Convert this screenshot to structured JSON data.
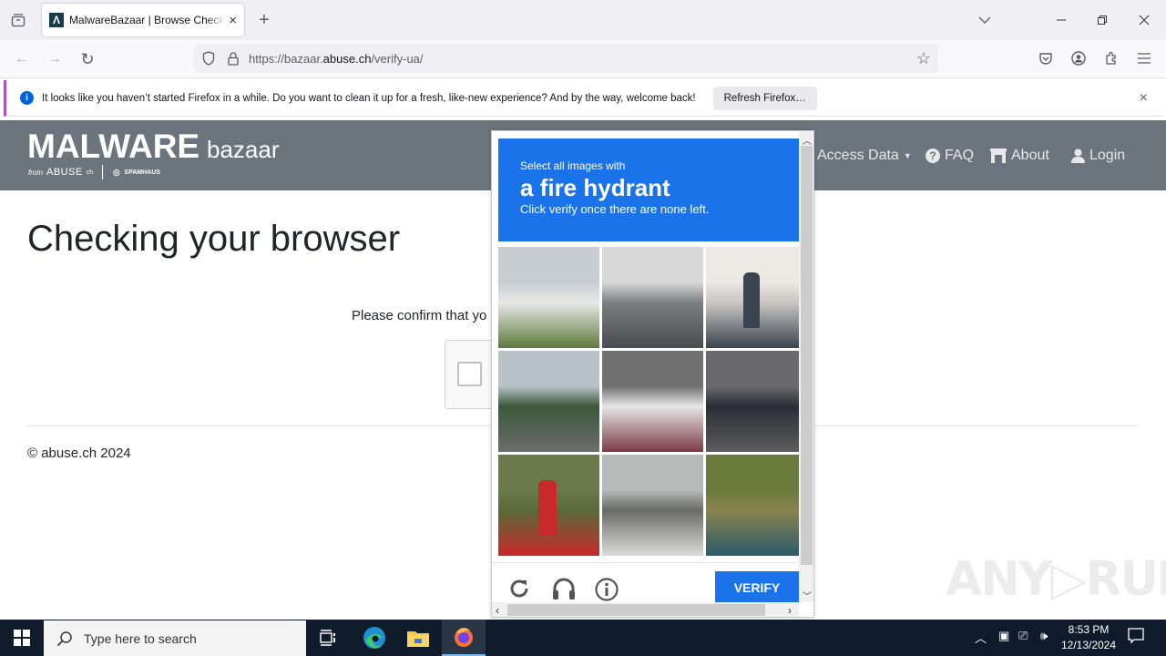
{
  "browser": {
    "tab_title": "MalwareBazaar | Browse Checking your browser",
    "tab_favicon": "Λ",
    "new_tab": "+",
    "url_prefix": "https://bazaar.",
    "url_domain": "abuse.ch",
    "url_path": "/verify-ua/",
    "icons": [
      "tab-list-icon",
      "back-icon",
      "forward-icon",
      "reload-icon",
      "shield-icon",
      "lock-icon",
      "star-icon",
      "pocket-icon",
      "account-icon",
      "extensions-icon",
      "menu-icon",
      "list-all-tabs-icon",
      "minimize-icon",
      "restore-icon",
      "close-icon"
    ]
  },
  "notification": {
    "message": "It looks like you haven’t started Firefox in a while. Do you want to clean it up for a fresh, like-new experience? And by the way, welcome back!",
    "button": "Refresh Firefox…",
    "close": "×"
  },
  "site": {
    "logo_main": "MALWARE",
    "logo_sub": "bazaar",
    "logo_from": "from",
    "logo_abuse": "ABUSE",
    "logo_ch": "ch",
    "logo_spamhaus": "SPAMHAUS",
    "nav": [
      {
        "label": "Access Data",
        "icon": "caret-down-icon"
      },
      {
        "label": "FAQ",
        "icon": "question-circle-icon"
      },
      {
        "label": "About",
        "icon": "building-icon"
      },
      {
        "label": "Login",
        "icon": "user-icon"
      }
    ]
  },
  "page": {
    "title": "Checking your browser",
    "confirm_text": "Please confirm that yo",
    "copyright": "© abuse.ch 2024"
  },
  "captcha": {
    "line1": "Select all images with",
    "target": "a fire hydrant",
    "line3": "Click verify once there are none left.",
    "tiles": [
      {
        "desc": "house",
        "colors": [
          "#c8cdd2",
          "#e8e8e6",
          "#5c7a3a"
        ]
      },
      {
        "desc": "highway traffic",
        "colors": [
          "#d8d8d8",
          "#7c7e80",
          "#4a4c50"
        ]
      },
      {
        "desc": "fire hydrant on sidewalk",
        "colors": [
          "#ece9e4",
          "#c9c6c2",
          "#3a4450"
        ]
      },
      {
        "desc": "road with traffic lights",
        "colors": [
          "#b8c2c8",
          "#3c5a3c",
          "#6c6c6c"
        ]
      },
      {
        "desc": "white van and red car",
        "colors": [
          "#707070",
          "#e6e6e8",
          "#7a3a42"
        ]
      },
      {
        "desc": "boy on bicycle",
        "colors": [
          "#6a6a6e",
          "#2a2e36",
          "#5c5c5c"
        ]
      },
      {
        "desc": "red fire hydrant in grass",
        "colors": [
          "#6a7a4a",
          "#5a6a3a",
          "#c82a2a"
        ]
      },
      {
        "desc": "crosswalk",
        "colors": [
          "#b6bab8",
          "#6a6a68",
          "#dcdcdc"
        ]
      },
      {
        "desc": "boat in harbor",
        "colors": [
          "#6a7a3a",
          "#8a8450",
          "#2a5a6a"
        ]
      }
    ],
    "verify": "VERIFY",
    "icons": [
      "reload-icon",
      "headphones-icon",
      "info-icon"
    ]
  },
  "watermark": "ANY▷RUN",
  "taskbar": {
    "search_placeholder": "Type here to search",
    "time": "8:53 PM",
    "date": "12/13/2024"
  }
}
